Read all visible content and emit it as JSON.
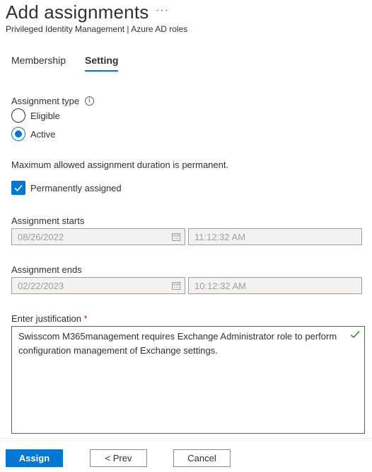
{
  "header": {
    "title": "Add assignments",
    "more_label": "···",
    "subtitle": "Privileged Identity Management | Azure AD roles"
  },
  "tabs": [
    {
      "label": "Membership",
      "active": false
    },
    {
      "label": "Setting",
      "active": true
    }
  ],
  "assignment_type": {
    "label": "Assignment type",
    "info_icon": "info-icon",
    "options": [
      {
        "label": "Eligible",
        "selected": false
      },
      {
        "label": "Active",
        "selected": true
      }
    ]
  },
  "duration_note": "Maximum allowed assignment duration is permanent.",
  "permanent": {
    "label": "Permanently assigned",
    "checked": true
  },
  "starts": {
    "label": "Assignment starts",
    "date": "08/26/2022",
    "time": "11:12:32 AM"
  },
  "ends": {
    "label": "Assignment ends",
    "date": "02/22/2023",
    "time": "10:12:32 AM"
  },
  "justification": {
    "label": "Enter justification",
    "required_mark": "*",
    "value": "Swisscom M365management requires Exchange Administrator role to perform configuration management of Exchange settings."
  },
  "footer": {
    "assign_label": "Assign",
    "prev_label": "< Prev",
    "cancel_label": "Cancel"
  },
  "colors": {
    "accent": "#0078d4",
    "required": "#a4262c",
    "valid": "#107c10"
  }
}
